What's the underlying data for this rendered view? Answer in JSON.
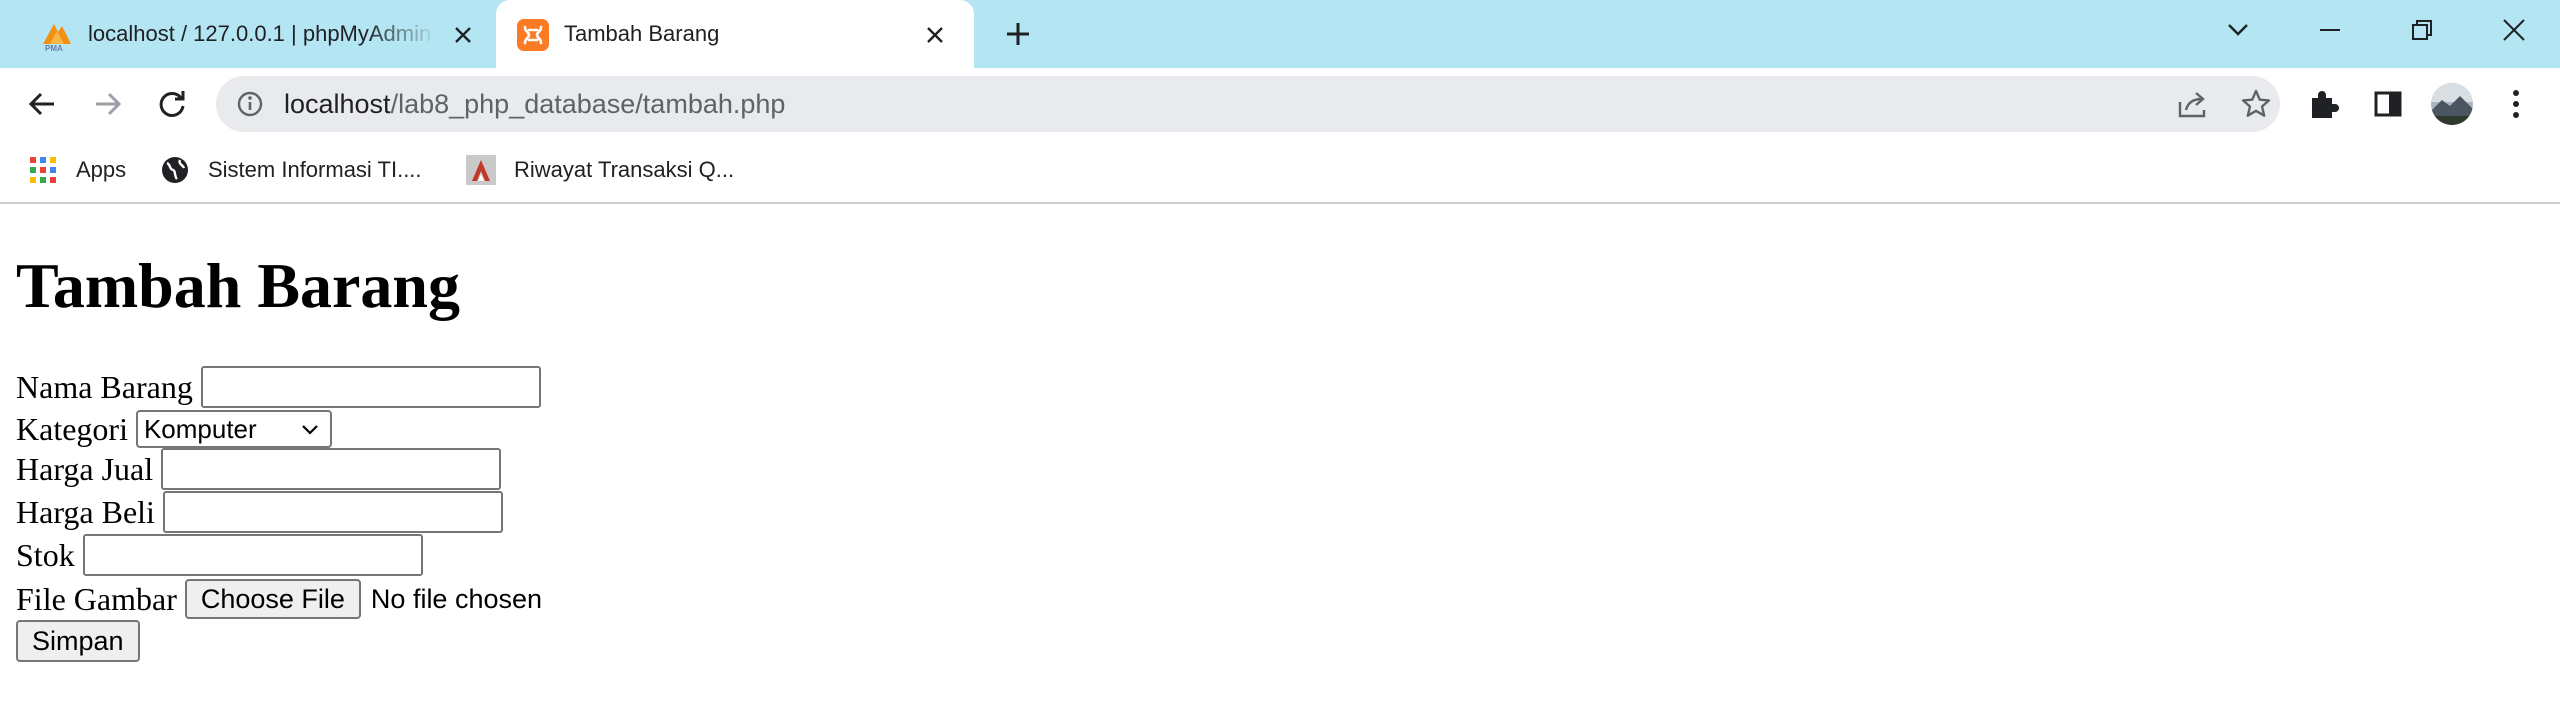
{
  "tabs": [
    {
      "title": "localhost / 127.0.0.1 | phpMyAdmin",
      "favicon": "phpmyadmin-icon",
      "active": false
    },
    {
      "title": "Tambah Barang",
      "favicon": "xampp-icon",
      "active": true
    }
  ],
  "toolbar": {
    "url_host": "localhost",
    "url_path": "/lab8_php_database/tambah.php"
  },
  "bookmarks": [
    {
      "label": "Apps",
      "icon": "apps-grid-icon"
    },
    {
      "label": "Sistem Informasi TI....",
      "icon": "globe-icon"
    },
    {
      "label": "Riwayat Transaksi Q...",
      "icon": "bookmark-favicon"
    }
  ],
  "page": {
    "heading": "Tambah Barang",
    "form": {
      "nama_label": "Nama Barang",
      "nama_value": "",
      "kategori_label": "Kategori",
      "kategori_selected": "Komputer",
      "harga_jual_label": "Harga Jual",
      "harga_jual_value": "",
      "harga_beli_label": "Harga Beli",
      "harga_beli_value": "",
      "stok_label": "Stok",
      "stok_value": "",
      "file_label": "File Gambar",
      "file_button": "Choose File",
      "file_status": "No file chosen",
      "submit_label": "Simpan"
    }
  },
  "colors": {
    "tabstrip_bg": "#b3e5f2",
    "omnibox_bg": "#e8eaed",
    "xampp_orange": "#fb7a24"
  }
}
